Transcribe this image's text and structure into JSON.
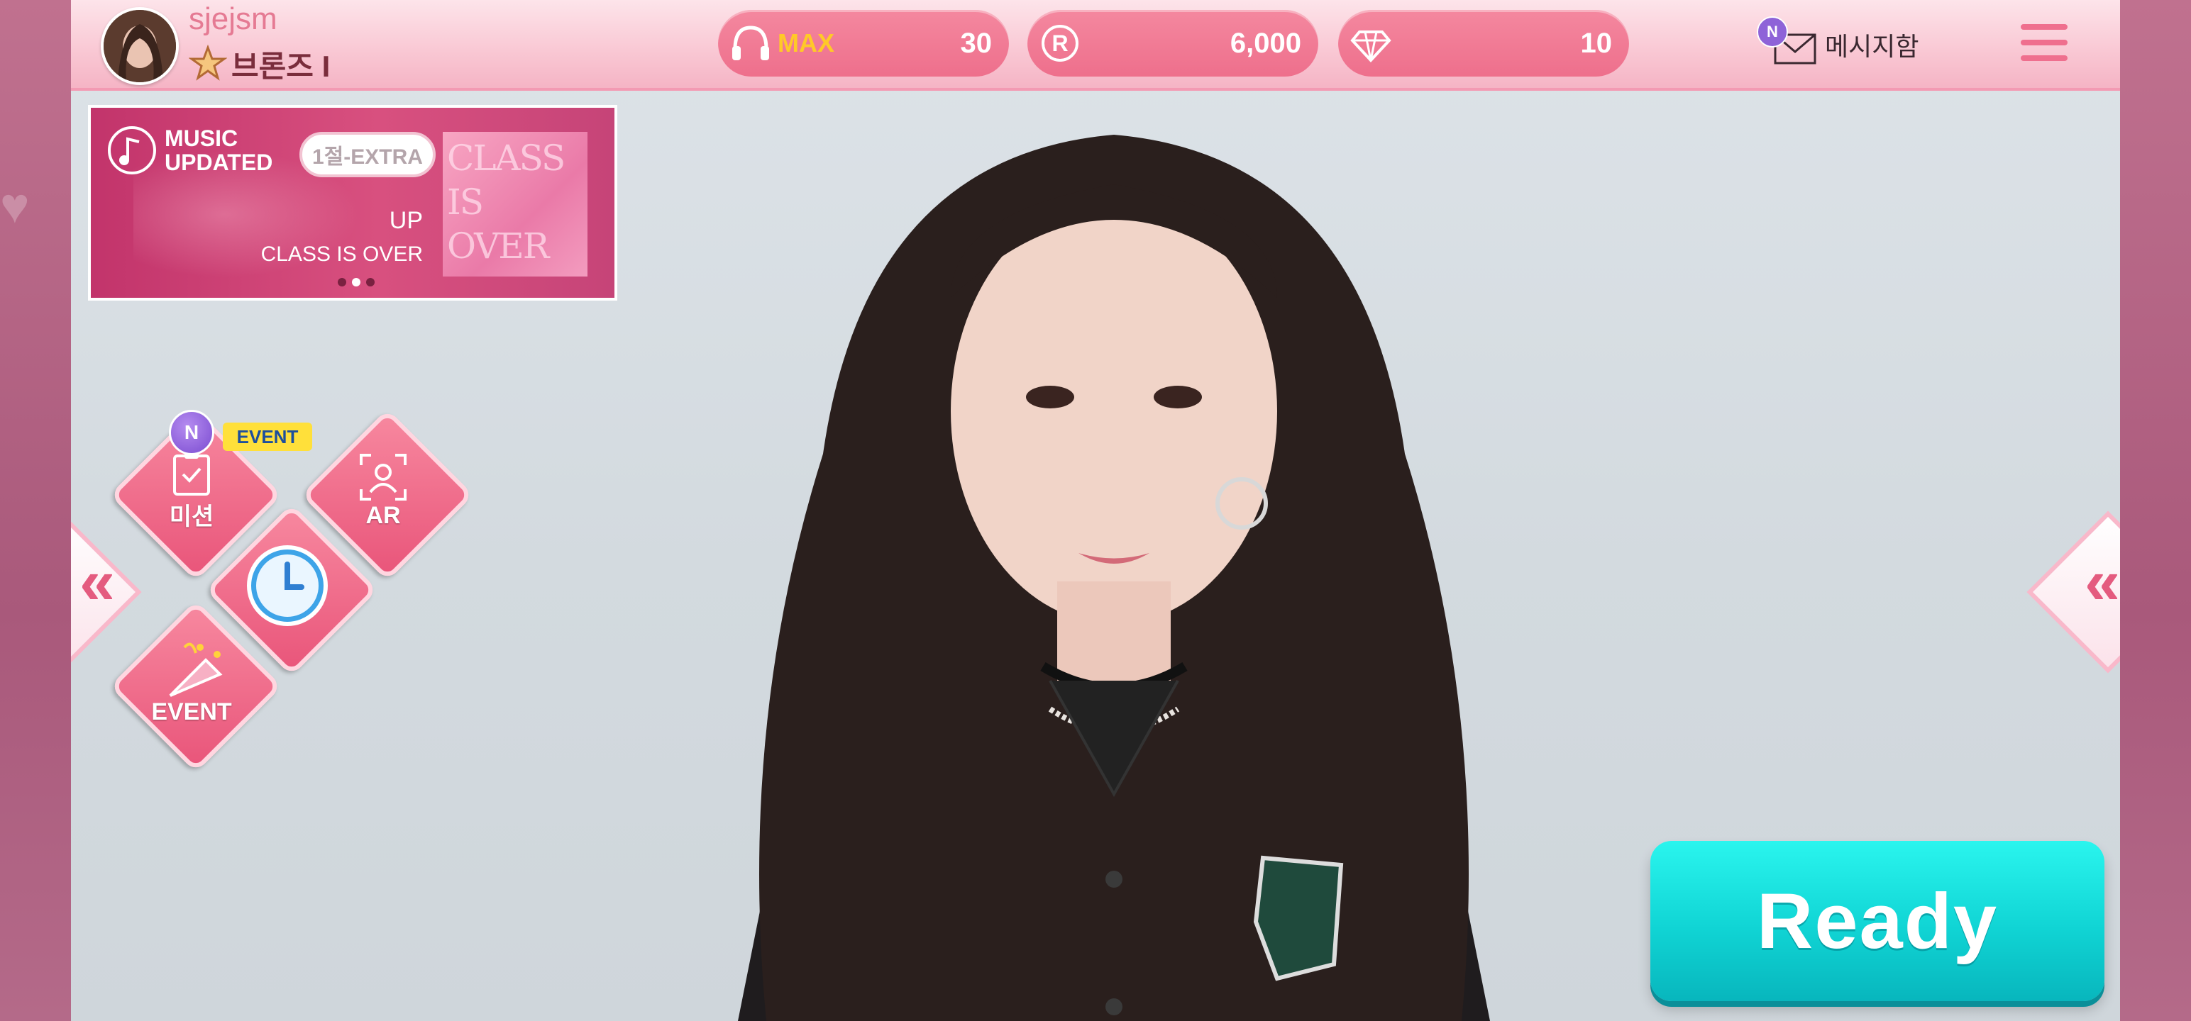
{
  "header": {
    "username": "sjejsm",
    "rank_label": "브론즈 I",
    "currencies": [
      {
        "icon": "headphones-icon",
        "tag": "MAX",
        "value": "30"
      },
      {
        "icon": "r-coin-icon",
        "tag": "",
        "value": "6,000"
      },
      {
        "icon": "diamond-icon",
        "tag": "",
        "value": "10"
      }
    ],
    "message_badge": "N",
    "message_label": "메시지함",
    "menu_icon": "hamburger-menu-icon"
  },
  "banner": {
    "music_label_line1": "MUSIC",
    "music_label_line2": "UPDATED",
    "tag": "1절-EXTRA",
    "up_label": "UP",
    "song_title": "CLASS IS OVER",
    "album_text": "CLASS IS OVER",
    "page_count": 3,
    "active_page": 2
  },
  "menu_buttons": {
    "mission": {
      "label": "미션",
      "badge": "N",
      "event_tag": "EVENT",
      "icon": "checklist-icon"
    },
    "ar": {
      "label": "AR",
      "icon": "ar-person-icon"
    },
    "clock": {
      "icon": "clock-icon"
    },
    "event": {
      "label": "EVENT",
      "icon": "party-popper-icon"
    }
  },
  "nav": {
    "left_icon": "double-chevron-left-icon",
    "right_icon": "double-chevron-left-icon"
  },
  "ready_label": "Ready",
  "colors": {
    "accent_pink": "#ee6f8c",
    "ready_cyan": "#10d4d4",
    "rank_text": "#7a2d3c"
  }
}
